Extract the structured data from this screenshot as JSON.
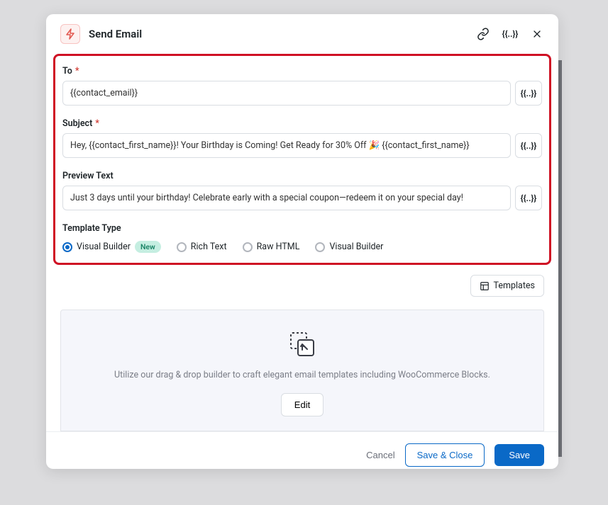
{
  "header": {
    "title": "Send Email"
  },
  "fields": {
    "to": {
      "label": "To",
      "required": "*",
      "value": "{{contact_email}}"
    },
    "subject": {
      "label": "Subject",
      "required": "*",
      "value": "Hey, {{contact_first_name}}! Your Birthday is Coming! Get Ready for 30% Off 🎉 {{contact_first_name}}"
    },
    "preview": {
      "label": "Preview Text",
      "value": "Just 3 days until your birthday! Celebrate early with a special coupon—redeem it on your special day!"
    },
    "templateType": {
      "label": "Template Type",
      "options": [
        {
          "label": "Visual Builder",
          "selected": true,
          "badge": "New"
        },
        {
          "label": "Rich Text",
          "selected": false
        },
        {
          "label": "Raw HTML",
          "selected": false
        },
        {
          "label": "Visual Builder",
          "selected": false
        }
      ]
    }
  },
  "mergeTagIcon": "{{..}}",
  "templatesButton": "Templates",
  "builder": {
    "description": "Utilize our drag & drop builder to craft elegant email templates including WooCommerce Blocks.",
    "editLabel": "Edit"
  },
  "footer": {
    "cancel": "Cancel",
    "saveClose": "Save & Close",
    "save": "Save"
  }
}
